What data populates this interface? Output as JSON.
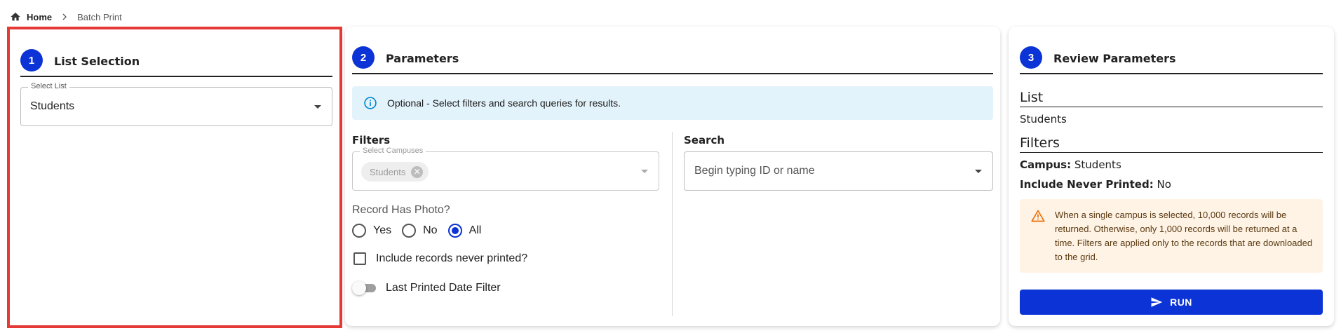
{
  "breadcrumb": {
    "home": "Home",
    "current": "Batch Print"
  },
  "steps": [
    {
      "number": "1",
      "title": "List Selection"
    },
    {
      "number": "2",
      "title": "Parameters"
    },
    {
      "number": "3",
      "title": "Review Parameters"
    }
  ],
  "list_selection": {
    "legend": "Select List",
    "value": "Students"
  },
  "parameters": {
    "info_text": "Optional - Select filters and search queries for results.",
    "filters_label": "Filters",
    "campus_legend": "Select Campuses",
    "campus_chip": "Students",
    "search_label": "Search",
    "search_placeholder": "Begin typing ID or name",
    "photo_label": "Record Has Photo?",
    "photo_options": [
      "Yes",
      "No",
      "All"
    ],
    "photo_selected": "All",
    "never_printed_label": "Include records never printed?",
    "never_printed_checked": false,
    "last_printed_label": "Last Printed Date Filter",
    "last_printed_on": false
  },
  "review": {
    "list_heading": "List",
    "list_value": "Students",
    "filters_heading": "Filters",
    "campus_key": "Campus:",
    "campus_value": "Students",
    "never_key": "Include Never Printed:",
    "never_value": "No",
    "warning": "When a single campus is selected, 10,000 records will be returned. Otherwise, only 1,000 records will be returned at a time. Filters are applied only to the records that are downloaded to the grid.",
    "run_label": "RUN"
  },
  "colors": {
    "accent": "#0b33d6",
    "highlight": "#e53935",
    "info_bg": "#e3f3fb",
    "warning_bg": "#fff3e6",
    "warning_icon": "#ed6c02"
  },
  "icons": {
    "home": "home-icon",
    "separator": "chevron-right-icon",
    "info": "info-icon",
    "warning": "warning-icon",
    "run": "send-icon"
  }
}
